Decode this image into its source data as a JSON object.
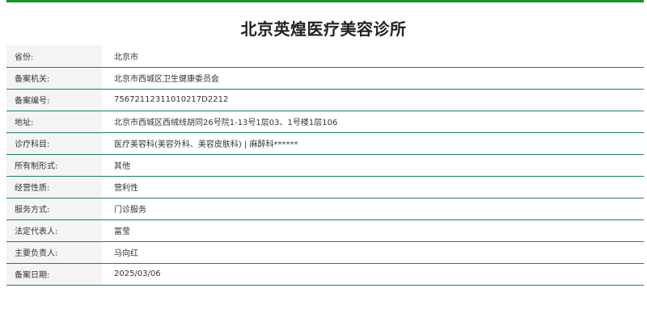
{
  "title": "北京英煌医疗美容诊所",
  "colors": {
    "accent_bar": "#1a8f2a",
    "row_divider": "#1f7a6e",
    "label_background": "#f4f4f4"
  },
  "rows": [
    {
      "label": "省份:",
      "value": "北京市"
    },
    {
      "label": "备案机关:",
      "value": "北京市西城区卫生健康委员会"
    },
    {
      "label": "备案编号:",
      "value": "75672112311010217D2212"
    },
    {
      "label": "地址:",
      "value": "北京市西城区西绒线胡同26号院1-13号1层03、1号楼1层106"
    },
    {
      "label": "诊疗科目:",
      "value": "医疗美容科(美容外科、美容皮肤科) | 麻醉科******"
    },
    {
      "label": "所有制形式:",
      "value": "其他"
    },
    {
      "label": "经营性质:",
      "value": "营利性"
    },
    {
      "label": "服务方式:",
      "value": "门诊服务"
    },
    {
      "label": "法定代表人:",
      "value": "富莹"
    },
    {
      "label": "主要负责人:",
      "value": "马向红"
    },
    {
      "label": "备案日期:",
      "value": "2025/03/06"
    }
  ]
}
